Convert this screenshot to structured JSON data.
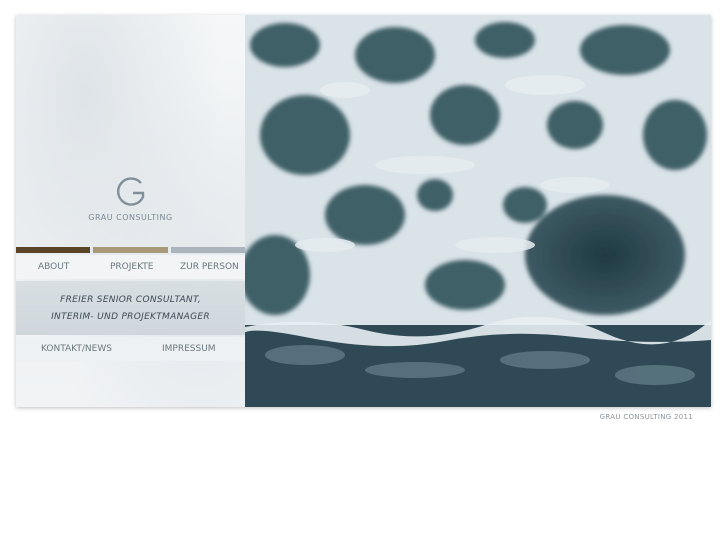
{
  "brand": {
    "logo_letter": "G",
    "name": "GRAU CONSULTING"
  },
  "nav_top": [
    {
      "label": "ABOUT"
    },
    {
      "label": "PROJEKTE"
    },
    {
      "label": "ZUR PERSON"
    }
  ],
  "tagline": {
    "line1": "FREIER SENIOR CONSULTANT,",
    "line2": "INTERIM- UND PROJEKTMANAGER"
  },
  "nav_bottom": [
    {
      "label": "KONTAKT/NEWS"
    },
    {
      "label": "IMPRESSUM"
    }
  ],
  "footer": {
    "copyright": "GRAU CONSULTING 2011"
  },
  "colors": {
    "bar_brown": "#5a4428",
    "bar_tan": "#a89a78",
    "bar_grey": "#a9b4bc",
    "water_dark": "#2e4a52",
    "foam": "#e8eef2"
  }
}
